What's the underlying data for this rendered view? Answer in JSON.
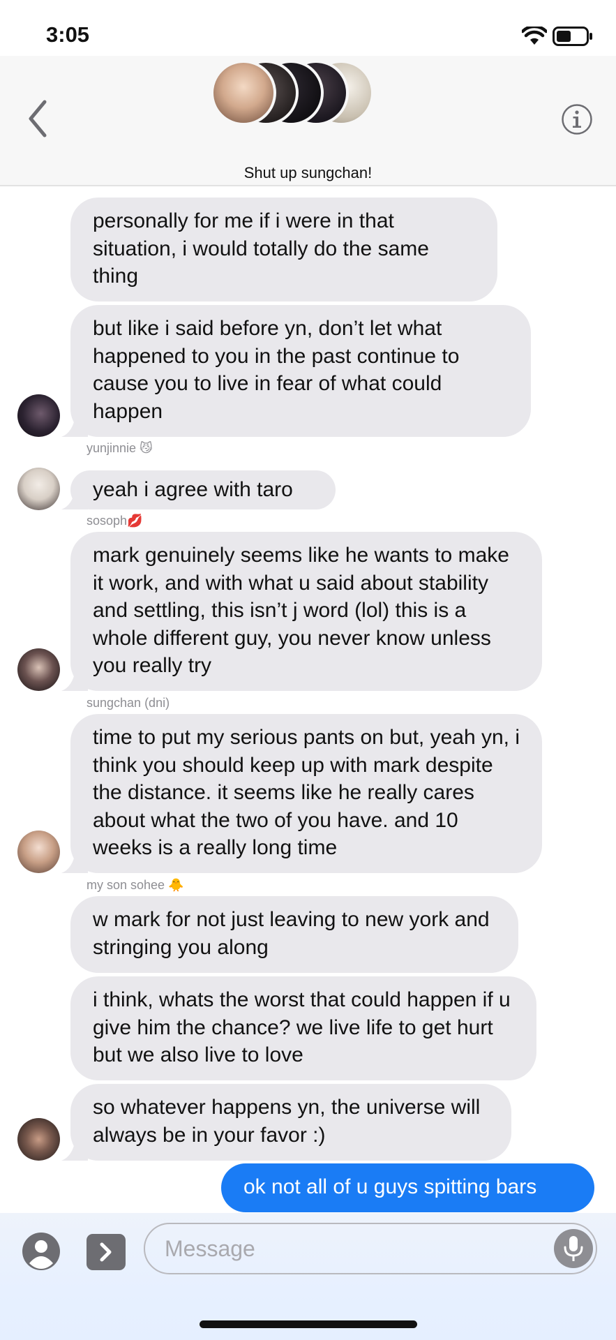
{
  "status_bar": {
    "time": "3:05"
  },
  "header": {
    "group_name": "Shut up sungchan!"
  },
  "messages": [
    {
      "text": "personally for me if i were in that situation, i would totally do the same thing"
    },
    {
      "text": "but like i said before yn, don’t let what happened to you in the past continue to cause you to live in fear of what could happen"
    },
    {
      "sender": "yunjinnie 😼",
      "text": "yeah i agree with taro"
    },
    {
      "sender": "sosoph💋",
      "text": "mark genuinely seems like he wants to make it work, and with what u said about stability and settling, this isn’t j word (lol) this is a whole different guy, you never know unless you really try"
    },
    {
      "sender": "sungchan (dni)",
      "text": "time to put my serious pants on but, yeah yn, i think you should keep up with mark despite the distance. it seems like he really cares about what the two of you have. and 10 weeks is a really long time"
    },
    {
      "sender": "my son sohee 🐥",
      "text": "w mark for not just leaving to new york and stringing you along"
    },
    {
      "text": "i think, whats the worst that could happen if u give him the chance? we live life to get hurt but we also live to love"
    },
    {
      "text": "so whatever happens yn, the universe will always be in your favor :)"
    },
    {
      "text": "ok not all of u guys spitting bars"
    }
  ],
  "input": {
    "placeholder": "Message"
  },
  "colors": {
    "sent_bubble": "#1a7cf5",
    "received_bubble": "#e9e8ec",
    "header_background": "#f7f7f7"
  },
  "icons": [
    "back-chevron-icon",
    "info-icon",
    "wifi-icon",
    "battery-icon",
    "contact-icon",
    "apps-chevron-icon",
    "microphone-icon"
  ]
}
